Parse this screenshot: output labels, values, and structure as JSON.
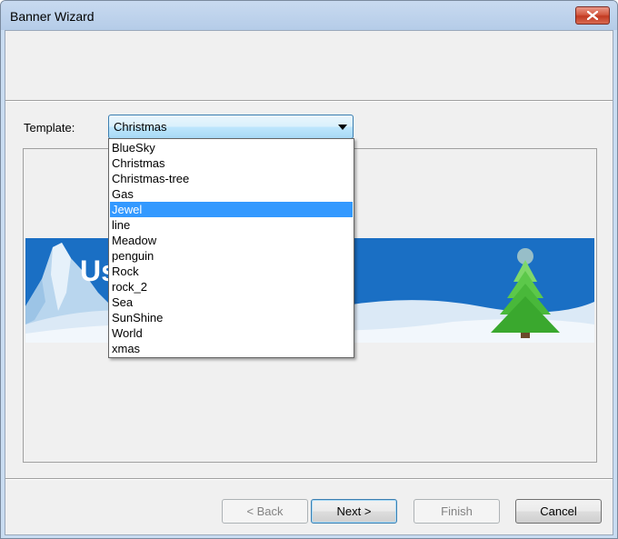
{
  "window": {
    "title": "Banner Wizard",
    "close_icon": "close-icon"
  },
  "template": {
    "label": "Template:",
    "selected": "Christmas",
    "options": [
      {
        "label": "BlueSky",
        "highlighted": false
      },
      {
        "label": "Christmas",
        "highlighted": false
      },
      {
        "label": "Christmas-tree",
        "highlighted": false
      },
      {
        "label": "Gas",
        "highlighted": false
      },
      {
        "label": "Jewel",
        "highlighted": true
      },
      {
        "label": "line",
        "highlighted": false
      },
      {
        "label": "Meadow",
        "highlighted": false
      },
      {
        "label": "penguin",
        "highlighted": false
      },
      {
        "label": "Rock",
        "highlighted": false
      },
      {
        "label": "rock_2",
        "highlighted": false
      },
      {
        "label": "Sea",
        "highlighted": false
      },
      {
        "label": "SunShine",
        "highlighted": false
      },
      {
        "label": "World",
        "highlighted": false
      },
      {
        "label": "xmas",
        "highlighted": false
      }
    ]
  },
  "preview": {
    "banner_text": "Us"
  },
  "buttons": {
    "back": "< Back",
    "next": "Next >",
    "finish": "Finish",
    "cancel": "Cancel"
  },
  "colors": {
    "selection": "#3399ff",
    "banner_sky": "#1a6fc4"
  }
}
